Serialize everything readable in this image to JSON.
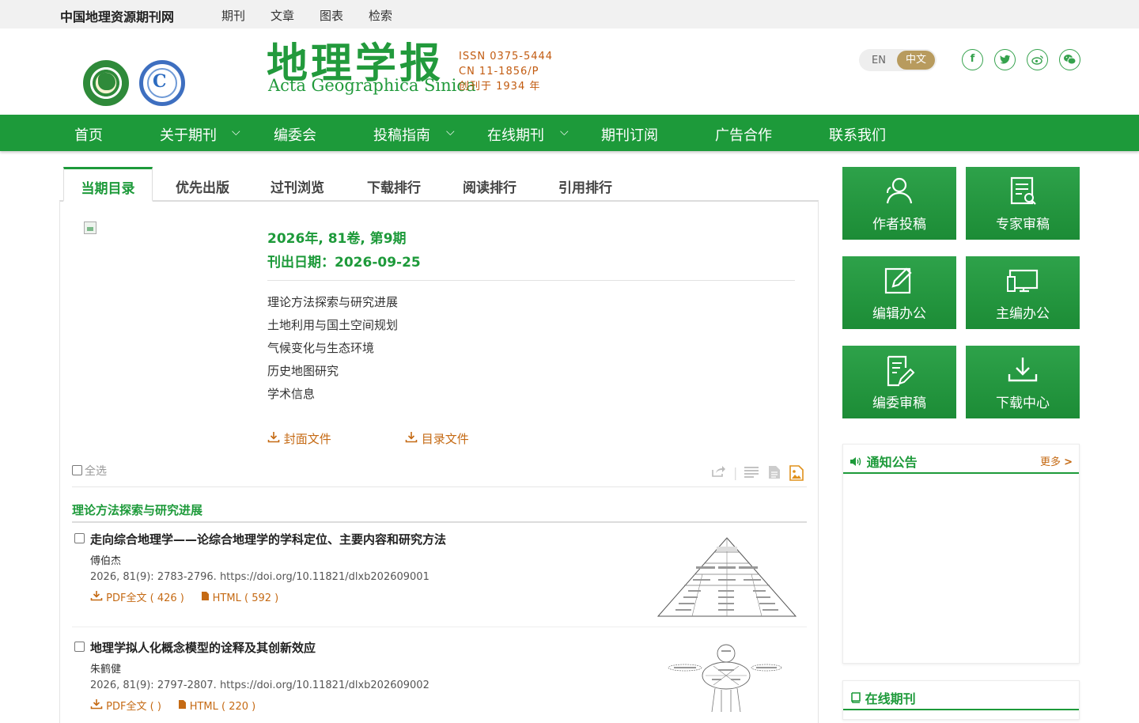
{
  "topbar": {
    "site_name": "中国地理资源期刊网",
    "nav": [
      "期刊",
      "文章",
      "图表",
      "检索"
    ]
  },
  "header": {
    "journal_cn": "地理学报",
    "journal_en": "Acta Geographica Sinica",
    "issn": "ISSN 0375-5444",
    "cn": "CN 11-1856/P",
    "founded": "创刊于 1934 年",
    "lang_en": "EN",
    "lang_zh": "中文",
    "social_icons": [
      "facebook-icon",
      "twitter-icon",
      "weibo-icon",
      "wechat-icon"
    ],
    "accent_color": "#1d9a3a"
  },
  "main_nav": [
    "首页",
    "关于期刊",
    "编委会",
    "投稿指南",
    "在线期刊",
    "期刊订阅",
    "广告合作",
    "联系我们"
  ],
  "tabs": [
    "当期目录",
    "优先出版",
    "过刊浏览",
    "下载排行",
    "阅读排行",
    "引用排行"
  ],
  "issue": {
    "volume": "2026年, 81卷, 第9期",
    "pub_date": "刊出日期：2026-09-25",
    "categories": [
      "理论方法探索与研究进展",
      "土地利用与国土空间规划",
      "气候变化与生态环境",
      "历史地图研究",
      "学术信息"
    ],
    "cover_file": "封面文件",
    "toc_file": "目录文件"
  },
  "list": {
    "select_all": "全选",
    "section": "理论方法探索与研究进展",
    "articles": [
      {
        "title": "走向综合地理学——论综合地理学的学科定位、主要内容和研究方法",
        "author": "傅伯杰",
        "meta": "2026, 81(9): 2783-2796.   https://doi.org/10.11821/dlxb202609001",
        "pdf_label": "PDF全文",
        "pdf_count": "( 426 )",
        "html_label": "HTML",
        "html_count": "( 592 )"
      },
      {
        "title": "地理学拟人化概念模型的诠释及其创新效应",
        "author": "朱鹤健",
        "meta": "2026, 81(9): 2797-2807.   https://doi.org/10.11821/dlxb202609002",
        "pdf_label": "PDF全文",
        "pdf_count": "( )",
        "html_label": "HTML",
        "html_count": "( 220 )"
      }
    ]
  },
  "sidebar": {
    "quick": [
      "作者投稿",
      "专家审稿",
      "编辑办公",
      "主编办公",
      "编委审稿",
      "下载中心"
    ],
    "notice_title": "通知公告",
    "more": "更多",
    "online_title": "在线期刊"
  }
}
